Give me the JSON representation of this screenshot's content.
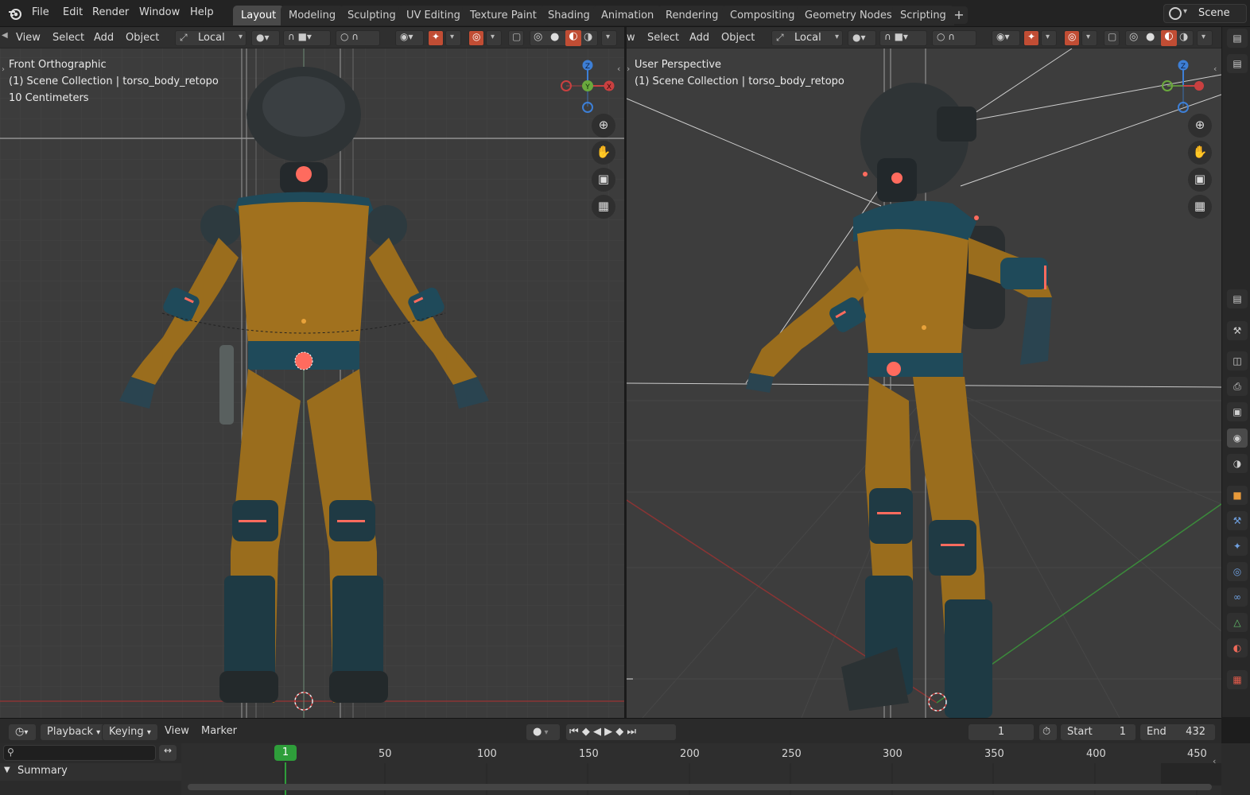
{
  "topbar": {
    "menus": [
      "File",
      "Edit",
      "Render",
      "Window",
      "Help"
    ],
    "workspaces": [
      "Layout",
      "Modeling",
      "Sculpting",
      "UV Editing",
      "Texture Paint",
      "Shading",
      "Animation",
      "Rendering",
      "Compositing",
      "Geometry Nodes",
      "Scripting"
    ],
    "active_workspace": "Layout",
    "add_tab_glyph": "+",
    "scene_label": "Scene"
  },
  "left_viewport": {
    "menus": [
      "View",
      "Select",
      "Add",
      "Object"
    ],
    "pivot_label": "Local",
    "view_name": "Front Orthographic",
    "collection_info": "(1) Scene Collection | torso_body_retopo",
    "scale_info": "10 Centimeters",
    "gizmo_axes": [
      "Z",
      "Y",
      "X"
    ]
  },
  "right_viewport": {
    "menus": [
      "Select",
      "Add",
      "Object"
    ],
    "truncated_menu": "w",
    "pivot_label": "Local",
    "view_name": "User Perspective",
    "collection_info": "(1) Scene Collection | torso_body_retopo",
    "gizmo_axes": [
      "Z"
    ]
  },
  "timeline": {
    "menus": [
      "Playback",
      "Keying",
      "View",
      "Marker"
    ],
    "current_frame": "1",
    "start_label": "Start",
    "start_value": "1",
    "end_label": "End",
    "end_value": "432",
    "ruler_numbers": [
      "50",
      "100",
      "150",
      "200",
      "250",
      "300",
      "350",
      "400",
      "450"
    ],
    "playhead_label": "1",
    "summary_label": "Summary"
  },
  "colors": {
    "accent_blue": "#4772b3",
    "axis_x": "#c94040",
    "axis_y": "#6aa93d",
    "axis_z": "#3d7fd6",
    "suit_orange": "#a1711e",
    "suit_teal": "#1f4a5a",
    "glow": "#ff6b5e",
    "playhead_green": "#2e9e3a"
  }
}
